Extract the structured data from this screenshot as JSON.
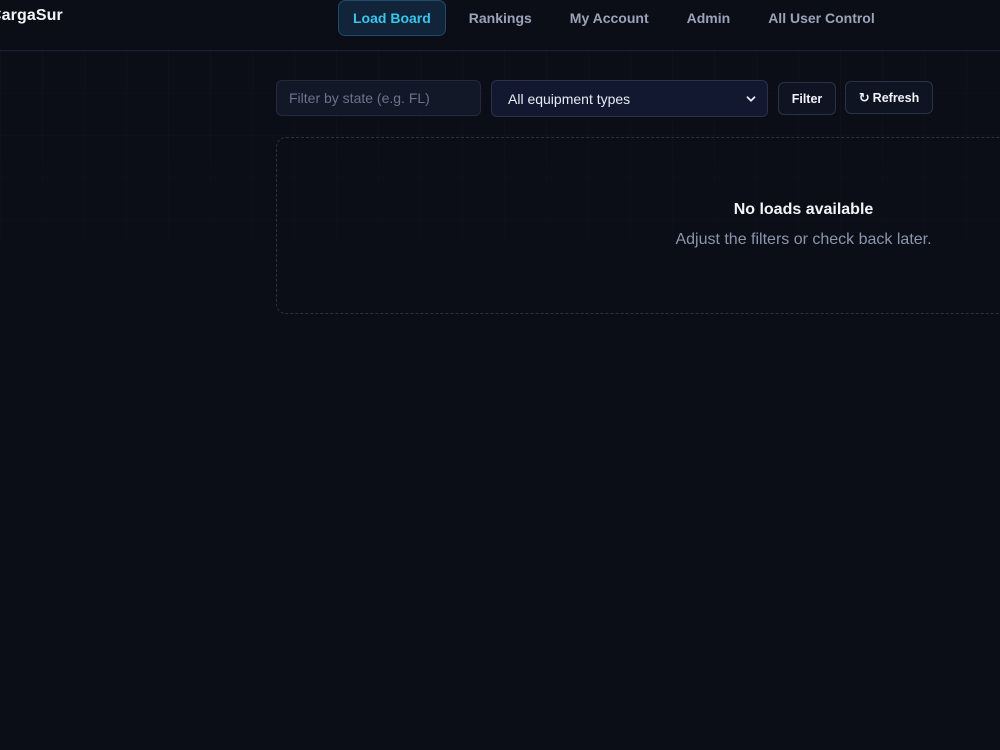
{
  "app": {
    "brand": "CargaSur"
  },
  "nav": {
    "items": [
      {
        "label": "Load Board",
        "active": true
      },
      {
        "label": "Rankings",
        "active": false
      },
      {
        "label": "My Account",
        "active": false
      },
      {
        "label": "Admin",
        "active": false
      },
      {
        "label": "All User Control",
        "active": false
      }
    ]
  },
  "filters": {
    "state_placeholder": "Filter by state (e.g. FL)",
    "state_value": "",
    "equipment_selected": "All equipment types",
    "filter_label": "Filter",
    "refresh_label": "Refresh",
    "refresh_icon": "refresh-icon"
  },
  "empty_state": {
    "title": "No loads available",
    "subtitle": "Adjust the filters or check back later."
  },
  "colors": {
    "background": "#0b0e17",
    "accent": "#38c6ec",
    "muted_text": "#8d95ad"
  }
}
